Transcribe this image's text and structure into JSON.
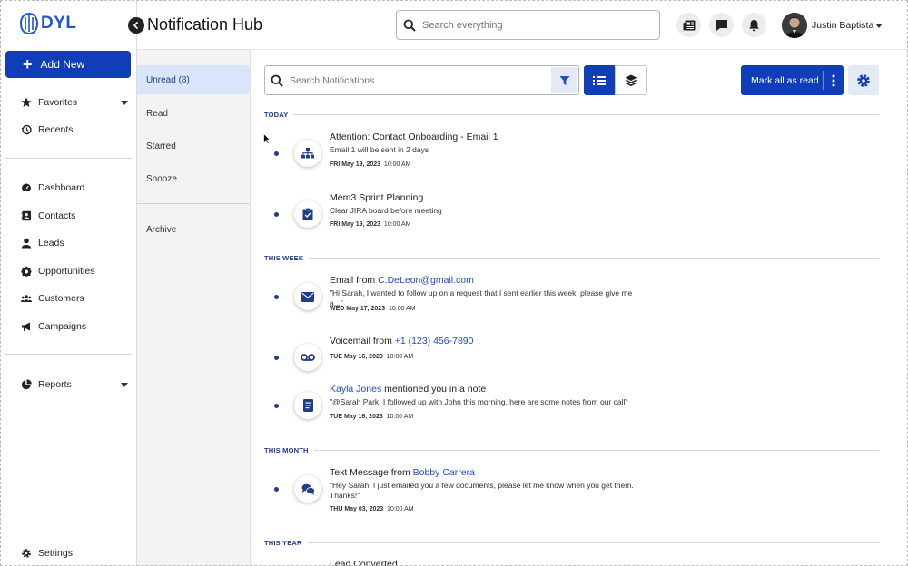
{
  "brand": {
    "logo_text": "DYL",
    "accent": "#0f3eb8",
    "link": "#1f4fb8",
    "section": "#1f3d8a"
  },
  "sidebar": {
    "add_new_label": "Add New",
    "items": [
      {
        "label": "Favorites",
        "icon": "star-icon"
      },
      {
        "label": "Recents",
        "icon": "history-icon"
      },
      {
        "label": "Dashboard",
        "icon": "dashboard-icon"
      },
      {
        "label": "Contacts",
        "icon": "contacts-icon"
      },
      {
        "label": "Leads",
        "icon": "person-icon"
      },
      {
        "label": "Opportunities",
        "icon": "opportunities-icon"
      },
      {
        "label": "Customers",
        "icon": "customers-icon"
      },
      {
        "label": "Campaigns",
        "icon": "megaphone-icon"
      },
      {
        "label": "Reports",
        "icon": "pie-chart-icon"
      },
      {
        "label": "Settings",
        "icon": "gear-icon"
      }
    ]
  },
  "header": {
    "title": "Notification Hub",
    "search_placeholder": "Search everything",
    "user_name": "Justin Baptista"
  },
  "filters": {
    "items": [
      {
        "label": "Unread (8)"
      },
      {
        "label": "Read"
      },
      {
        "label": "Starred"
      },
      {
        "label": "Snooze"
      },
      {
        "label": "Archive"
      }
    ]
  },
  "toolbar": {
    "search_placeholder": "Search Notifications",
    "mark_all_label": "Mark all as read"
  },
  "sections": {
    "today": "TODAY",
    "this_week": "THIS WEEK",
    "this_month": "THIS MONTH",
    "this_year": "THIS YEAR"
  },
  "notifications": [
    {
      "title": "Attention: Contact Onboarding - Email 1",
      "title_link": "",
      "title_suffix": "",
      "body": "Email 1 will be sent in 2 days",
      "date": "FRI May 19, 2023",
      "time": "10:00 AM",
      "icon": "org-chart-icon"
    },
    {
      "title": "Mem3 Sprint Planning",
      "title_link": "",
      "title_suffix": "",
      "body": "Clear JIRA board before meeting",
      "date": "FRI May 19, 2023",
      "time": "10:00 AM",
      "icon": "clipboard-check-icon"
    },
    {
      "title": "Email from ",
      "title_link": "C.DeLeon@gmail.com",
      "title_suffix": "",
      "body": "\"Hi Sarah, I wanted to follow up on a request that I sent earlier this week, please give me a...\"",
      "date": "WED May 17, 2023",
      "time": "10:00 AM",
      "icon": "envelope-icon"
    },
    {
      "title": "Voicemail from ",
      "title_link": "+1 (123) 456-7890",
      "title_suffix": "",
      "body": "",
      "date": "TUE May 16, 2023",
      "time": "10:00 AM",
      "icon": "voicemail-icon"
    },
    {
      "title": "",
      "title_link": "Kayla Jones",
      "title_suffix": " mentioned you in a note",
      "body": "\"@Sarah Park, I followed up with John this morning, here are some notes from our call\"",
      "date": "TUE May 16, 2023",
      "time": "10:00 AM",
      "icon": "note-icon"
    },
    {
      "title": "Text Message from ",
      "title_link": "Bobby Carrera",
      "title_suffix": "",
      "body": "\"Hey Sarah, I just emailed you a few documents, please let me know when you get them. Thanks!\"",
      "date": "THU May 03, 2023",
      "time": "10:00 AM",
      "icon": "chat-bubbles-icon"
    },
    {
      "title": "Lead Converted",
      "title_link": "",
      "title_suffix": "",
      "body": "",
      "date": "",
      "time": "",
      "icon": ""
    }
  ]
}
